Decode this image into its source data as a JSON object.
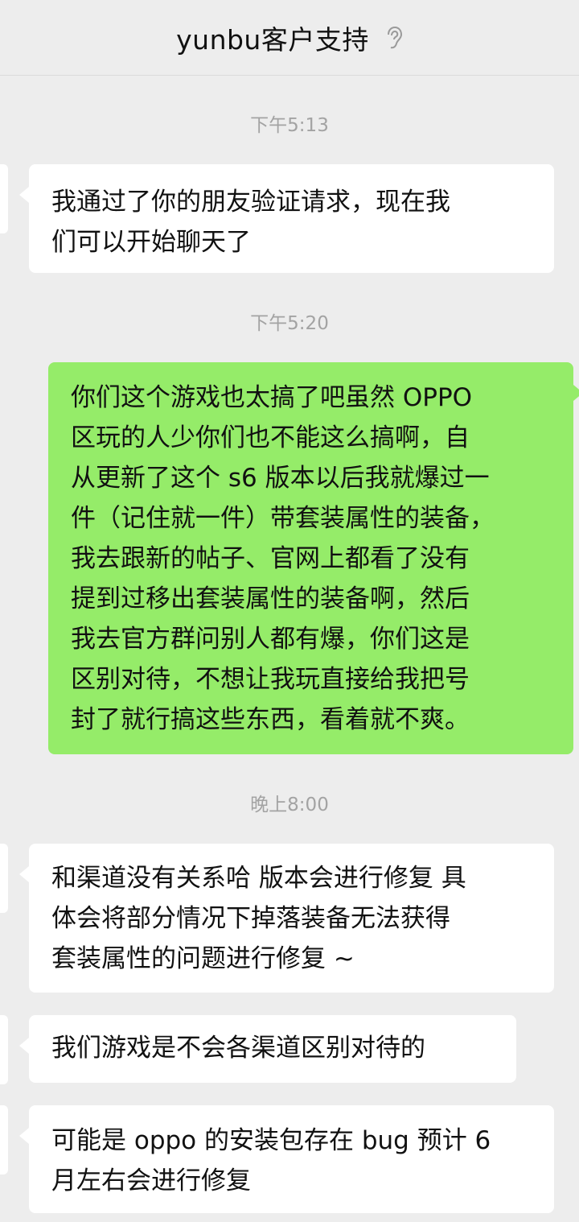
{
  "header": {
    "title": "yunbu客户支持",
    "icon": "ear-icon"
  },
  "timestamps": [
    "下午5:13",
    "下午5:20",
    "晚上8:00"
  ],
  "messages": [
    {
      "direction": "incoming",
      "text": "我通过了你的朋友验证请求，现在我\n们可以开始聊天了"
    },
    {
      "direction": "outgoing",
      "text": "你们这个游戏也太搞了吧虽然 OPPO\n区玩的人少你们也不能这么搞啊，自\n从更新了这个 s6 版本以后我就爆过一\n件（记住就一件）带套装属性的装备，\n我去跟新的帖子、官网上都看了没有\n提到过移出套装属性的装备啊，然后\n我去官方群问别人都有爆，你们这是\n区别对待，不想让我玩直接给我把号\n封了就行搞这些东西，看着就不爽。"
    },
    {
      "direction": "incoming",
      "text": "和渠道没有关系哈 版本会进行修复 具\n体会将部分情况下掉落装备无法获得\n套装属性的问题进行修复 ~"
    },
    {
      "direction": "incoming",
      "text": "我们游戏是不会各渠道区别对待的"
    },
    {
      "direction": "incoming",
      "text": "可能是 oppo 的安装包存在 bug 预计 6\n月左右会进行修复"
    }
  ],
  "colors": {
    "background": "#ededed",
    "incoming_bubble": "#ffffff",
    "outgoing_bubble": "#95ec69",
    "timestamp": "#a3a3a3"
  }
}
